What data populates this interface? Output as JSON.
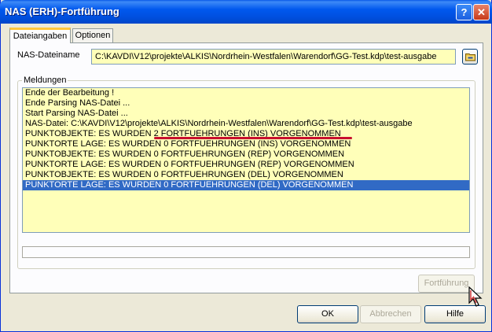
{
  "window": {
    "title": "NAS (ERH)-Fortführung",
    "help_glyph": "?",
    "close_glyph": "✕"
  },
  "tabs": [
    {
      "label": "Dateiangaben",
      "active": true
    },
    {
      "label": "Optionen",
      "active": false
    }
  ],
  "nas_file": {
    "label": "NAS-Dateiname",
    "value": "C:\\KAVDI\\V12\\projekte\\ALKIS\\Nordrhein-Westfalen\\Warendorf\\GG-Test.kdp\\test-ausgabe",
    "browse_icon": "folder-icon"
  },
  "messages": {
    "group_label": "Meldungen",
    "items": [
      "Ende der Bearbeitung !",
      "Ende Parsing NAS-Datei ...",
      "Start Parsing NAS-Datei ...",
      "NAS-Datei: C:\\KAVDI\\V12\\projekte\\ALKIS\\Nordrhein-Westfalen\\Warendorf\\GG-Test.kdp\\test-ausgabe",
      "PUNKTOBJEKTE:    ES WURDEN 2 FORTFUEHRUNGEN (INS) VORGENOMMEN",
      "PUNKTORTE LAGE: ES WURDEN 0 FORTFUEHRUNGEN (INS) VORGENOMMEN",
      "PUNKTOBJEKTE:    ES WURDEN 0 FORTFUEHRUNGEN (REP) VORGENOMMEN",
      "PUNKTORTE LAGE: ES WURDEN 0 FORTFUEHRUNGEN (REP) VORGENOMMEN",
      "PUNKTOBJEKTE:    ES WURDEN 0 FORTFUEHRUNGEN (DEL) VORGENOMMEN",
      "PUNKTORTE LAGE: ES WURDEN 0 FORTFUEHRUNGEN (DEL) VORGENOMMEN"
    ],
    "selected_index": 9,
    "highlight_color": "#c8102e"
  },
  "progress": 0,
  "buttons": {
    "fortfuehrung": "Fortführung",
    "ok": "OK",
    "abbrechen": "Abbrechen",
    "hilfe": "Hilfe"
  }
}
